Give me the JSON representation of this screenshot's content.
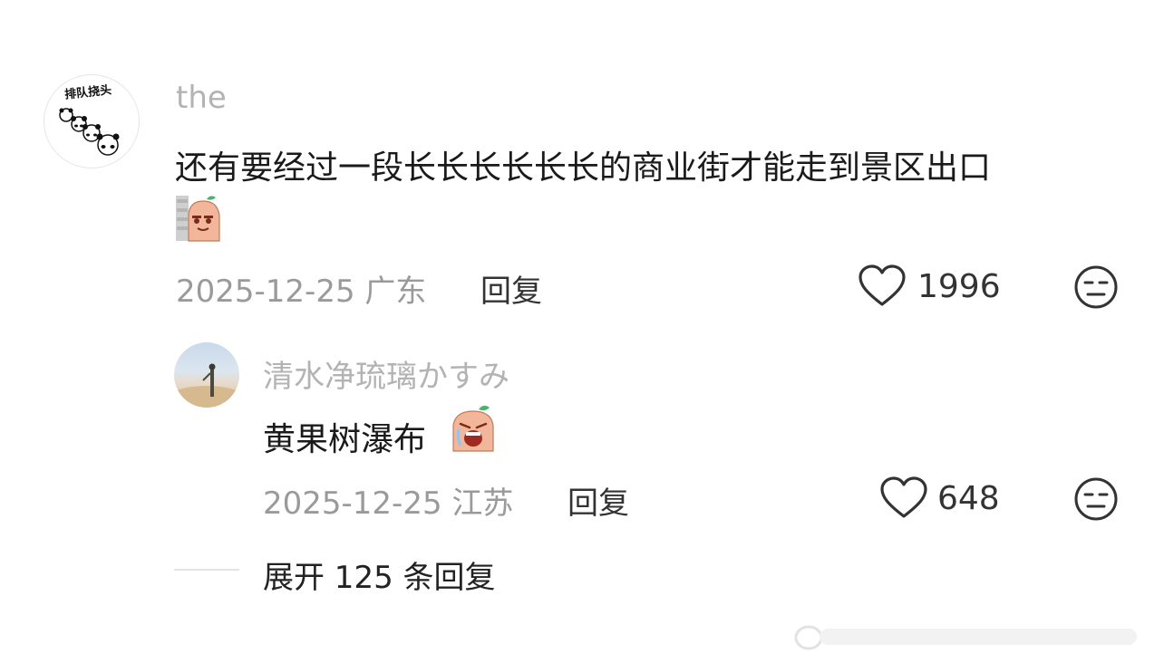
{
  "comment": {
    "avatar_text": "排队挠头",
    "username": "the",
    "text": "还有要经过一段长长长长长长的商业街才能走到景区出口",
    "date": "2025-12-25",
    "location": "广东",
    "reply_label": "回复",
    "like_count": "1996"
  },
  "reply": {
    "username": "清水净琉璃かすみ",
    "text": "黄果树瀑布",
    "date": "2025-12-25",
    "location": "江苏",
    "reply_label": "回复",
    "like_count": "648"
  },
  "expand_label": "展开 125 条回复",
  "colors": {
    "username": "#b3b3b3",
    "meta": "#9a9a9a",
    "text": "#1a1a1a"
  }
}
